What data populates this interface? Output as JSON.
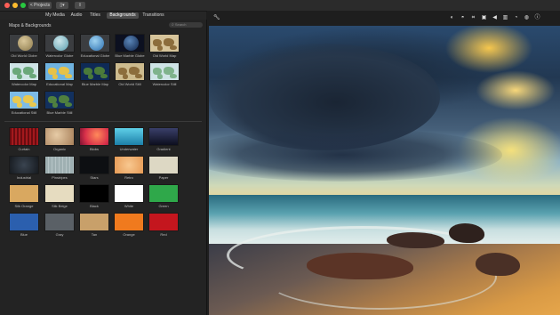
{
  "toolbar": {
    "projects_label": "< Projects",
    "media_label": "▯▾",
    "share_label": "⇧"
  },
  "tabs": [
    {
      "label": "My Media",
      "active": false
    },
    {
      "label": "Audio",
      "active": false
    },
    {
      "label": "Titles",
      "active": false
    },
    {
      "label": "Backgrounds",
      "active": true
    },
    {
      "label": "Transitions",
      "active": false
    }
  ],
  "browser": {
    "section_title": "Maps & Backgrounds",
    "search_placeholder": "Search",
    "maps": [
      {
        "label": "Old World Globe"
      },
      {
        "label": "Watercolor Globe"
      },
      {
        "label": "Educational Globe"
      },
      {
        "label": "Blue Marble Globe"
      },
      {
        "label": "Old World Map"
      },
      {
        "label": "Watercolor Map"
      },
      {
        "label": "Educational Map"
      },
      {
        "label": "Blue Marble Map"
      },
      {
        "label": "Old World Still"
      },
      {
        "label": "Watercolor Still"
      },
      {
        "label": "Educational Still"
      },
      {
        "label": "Blue Marble Still"
      }
    ],
    "backgrounds": [
      {
        "label": "Curtain",
        "color": "#8a1416"
      },
      {
        "label": "Organic",
        "color": "#c49a72"
      },
      {
        "label": "Blobs",
        "color": "#d8304a"
      },
      {
        "label": "Underwater",
        "color": "#2fa6c8"
      },
      {
        "label": "Gradient",
        "color": "#1c1f3a"
      },
      {
        "label": "Industrial",
        "color": "#2a3038"
      },
      {
        "label": "Pinstripes",
        "color": "#9fb0b2"
      },
      {
        "label": "Stars",
        "color": "#0d0f12"
      },
      {
        "label": "Retro",
        "color": "#f2b070"
      },
      {
        "label": "Paper",
        "color": "#ddd8c4"
      },
      {
        "label": "Silk Orange",
        "color": "#d9a860"
      },
      {
        "label": "Silk Beige",
        "color": "#e6dcc0"
      },
      {
        "label": "Black",
        "color": "#000000"
      },
      {
        "label": "White",
        "color": "#ffffff"
      },
      {
        "label": "Green",
        "color": "#2fa84a"
      },
      {
        "label": "Blue",
        "color": "#2b5fae"
      },
      {
        "label": "Gray",
        "color": "#5a6066"
      },
      {
        "label": "Tan",
        "color": "#c8a06a"
      },
      {
        "label": "Orange",
        "color": "#f07a1e"
      },
      {
        "label": "Red",
        "color": "#c4161e"
      }
    ]
  },
  "viewer_icons": [
    {
      "name": "color-balance-icon",
      "glyph": "◐"
    },
    {
      "name": "color-correction-icon",
      "glyph": "◓"
    },
    {
      "name": "crop-icon",
      "glyph": "⌗"
    },
    {
      "name": "stabilization-icon",
      "glyph": "▣"
    },
    {
      "name": "volume-icon",
      "glyph": "◀"
    },
    {
      "name": "noise-reduction-icon",
      "glyph": "▥"
    },
    {
      "name": "speed-icon",
      "glyph": "◔"
    },
    {
      "name": "clip-filter-icon",
      "glyph": "◍"
    },
    {
      "name": "info-icon",
      "glyph": "ⓘ"
    }
  ]
}
